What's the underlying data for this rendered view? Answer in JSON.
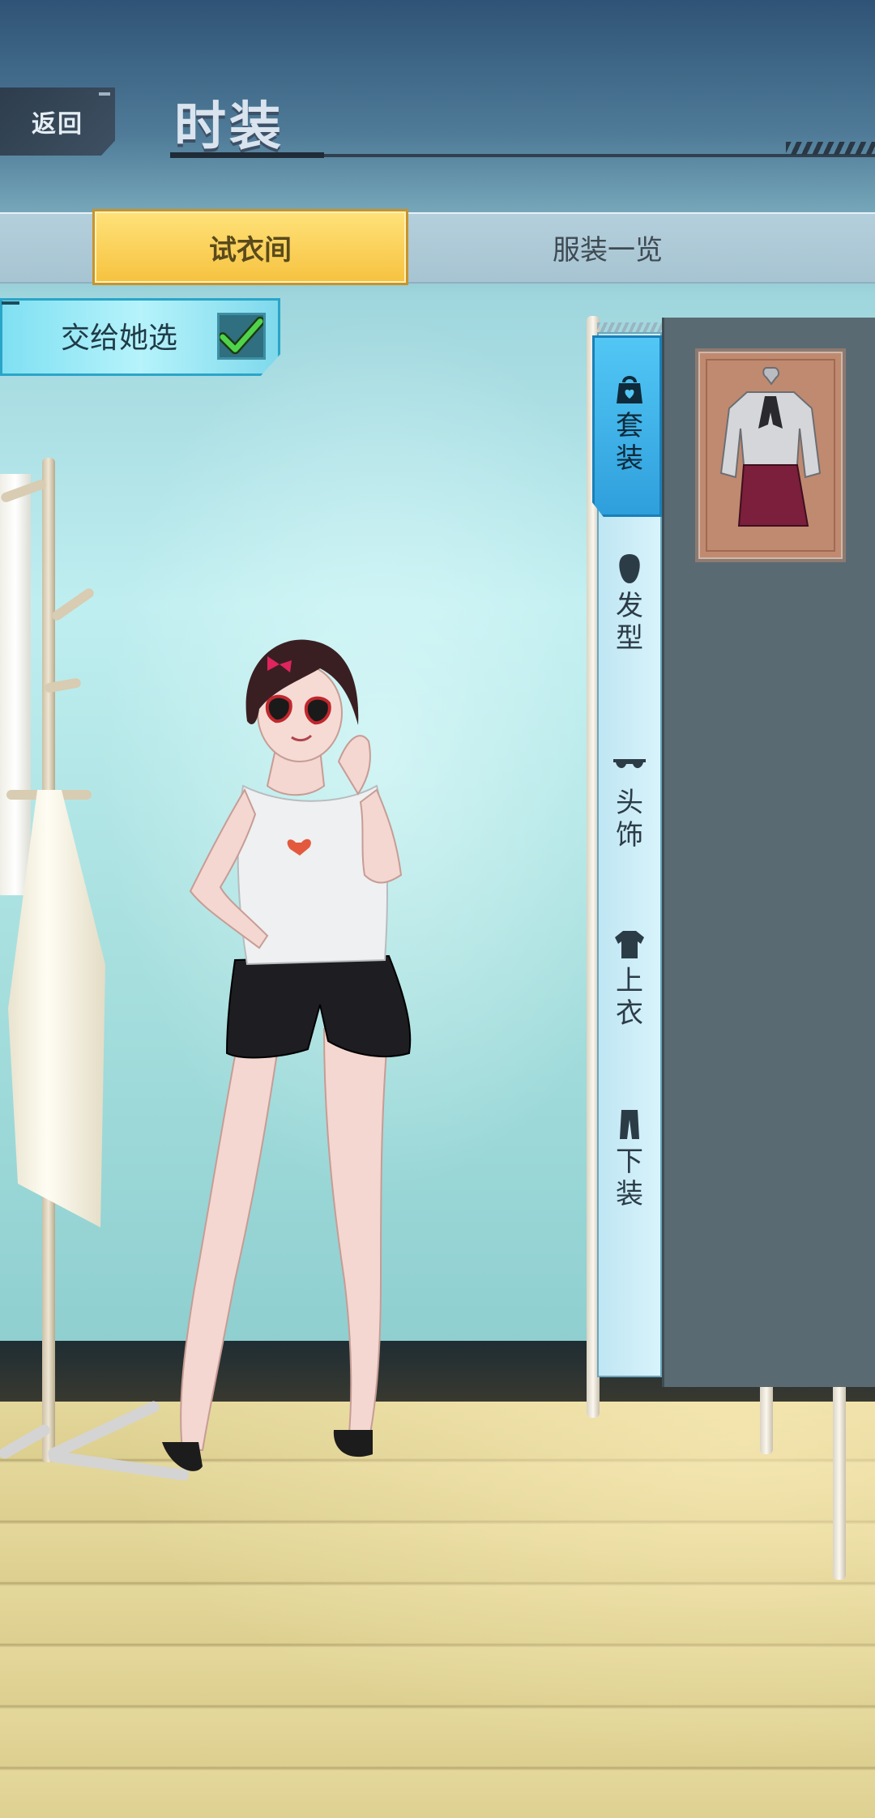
{
  "header": {
    "back_label": "返回",
    "title": "时装"
  },
  "tabs": [
    {
      "label": "试衣间",
      "active": true
    },
    {
      "label": "服装一览",
      "active": false
    }
  ],
  "choose_toggle": {
    "label": "交给她选",
    "checked": true
  },
  "categories": [
    {
      "id": "outfit",
      "chars": [
        "套",
        "装"
      ],
      "icon": "outfit-bag-icon",
      "active": true
    },
    {
      "id": "hair",
      "chars": [
        "发",
        "型"
      ],
      "icon": "hair-head-icon",
      "active": false
    },
    {
      "id": "headwear",
      "chars": [
        "头",
        "饰"
      ],
      "icon": "sunglasses-icon",
      "active": false
    },
    {
      "id": "top",
      "chars": [
        "上",
        "衣"
      ],
      "icon": "shirt-icon",
      "active": false
    },
    {
      "id": "bottom",
      "chars": [
        "下",
        "装"
      ],
      "icon": "pants-icon",
      "active": false
    }
  ],
  "items": [
    {
      "name": "blouse-and-skirt-outfit",
      "icon": "outfit-preview"
    }
  ],
  "colors": {
    "active_tab": "#f6c23f",
    "active_category": "#2f9fdc",
    "toggle_bg": "#7fe0f2",
    "panel_bg": "#5a6a73",
    "check_green": "#4fd34a"
  }
}
